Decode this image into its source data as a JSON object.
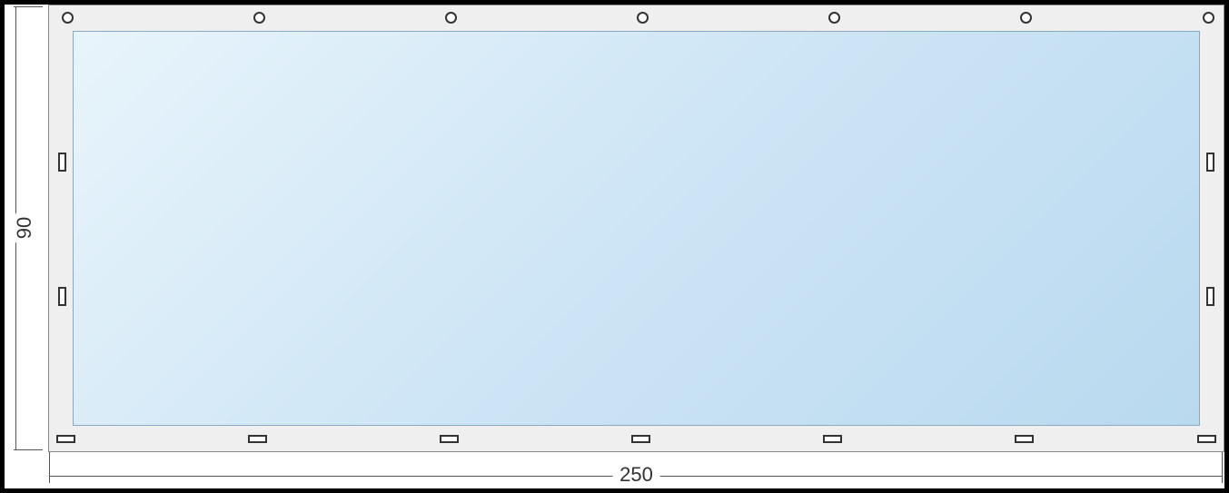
{
  "dimensions": {
    "height_label": "90",
    "width_label": "250"
  },
  "markers": {
    "top_circles_count": 7,
    "bottom_slots_count": 7,
    "left_slots_count": 2,
    "right_slots_count": 2
  },
  "colors": {
    "frame_bg": "#efefef",
    "canvas_gradient_start": "#e8f4fb",
    "canvas_gradient_end": "#b9d9ef"
  }
}
